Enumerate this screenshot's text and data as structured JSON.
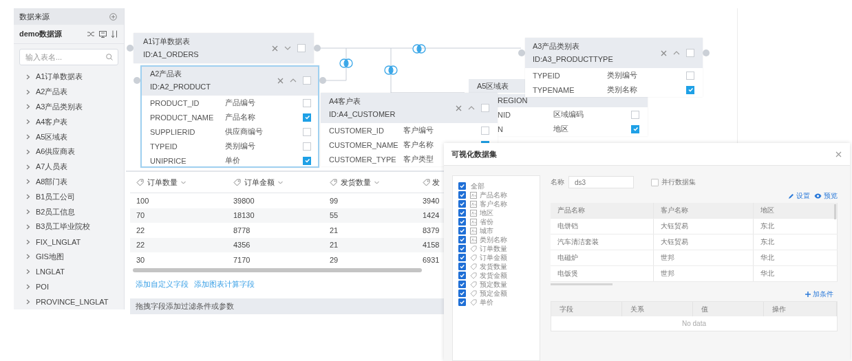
{
  "sidebar": {
    "title": "数据来源",
    "source": "demo数据源",
    "search": {
      "placeholder": "输入表名..."
    },
    "items": [
      {
        "label": "A1订单数据表",
        "expanded": false
      },
      {
        "label": "A2产品表",
        "expanded": false
      },
      {
        "label": "A3产品类别表",
        "expanded": false
      },
      {
        "label": "A4客户表",
        "expanded": false
      },
      {
        "label": "A5区域表",
        "expanded": false
      },
      {
        "label": "A6供应商表",
        "expanded": false
      },
      {
        "label": "A7人员表",
        "expanded": false
      },
      {
        "label": "A8部门表",
        "expanded": false
      },
      {
        "label": "B1员工公司",
        "expanded": false
      },
      {
        "label": "B2员工信息",
        "expanded": false
      },
      {
        "label": "B3员工毕业院校",
        "expanded": false
      },
      {
        "label": "FIX_LNGLAT",
        "expanded": false
      },
      {
        "label": "GIS地图",
        "expanded": false
      },
      {
        "label": "LNGLAT",
        "expanded": false
      },
      {
        "label": "POI",
        "expanded": false
      },
      {
        "label": "PROVINCE_LNGLAT",
        "expanded": false
      }
    ]
  },
  "canvas": {
    "nodes": [
      {
        "title": "A5区域表",
        "id": "REGION",
        "fields": [
          {
            "name": "NID",
            "label": "区域编码",
            "checked": false
          },
          {
            "name": "N",
            "label": "地区",
            "checked": true
          }
        ]
      },
      {
        "title": "A4客户表",
        "id": "ID:A4_CUSTOMER",
        "collapsed": false,
        "checked": false,
        "fields": [
          {
            "name": "CUSTOMER_ID",
            "label": "客户编号",
            "checked": false
          },
          {
            "name": "CUSTOMER_NAME",
            "label": "客户名称",
            "checked": true
          },
          {
            "name": "CUSTOMER_TYPE",
            "label": "客户类型"
          }
        ]
      },
      {
        "title": "A1订单数据表",
        "id": "ID:A1_ORDERS",
        "collapsed": true,
        "checked": false
      },
      {
        "title": "A2产品表",
        "id": "ID:A2_PRODUCT",
        "collapsed": false,
        "checked": false,
        "selected": true,
        "fields": [
          {
            "name": "PRODUCT_ID",
            "label": "产品编号",
            "checked": false
          },
          {
            "name": "PRODUCT_NAME",
            "label": "产品名称",
            "checked": true
          },
          {
            "name": "SUPPLIERID",
            "label": "供应商编号",
            "checked": false
          },
          {
            "name": "TYPEID",
            "label": "类别编号",
            "checked": false
          },
          {
            "name": "UNIPRICE",
            "label": "单价",
            "checked": true
          }
        ]
      },
      {
        "title": "A3产品类别表",
        "id": "ID:A3_PRODUCTTYPE",
        "collapsed": false,
        "checked": false,
        "fields": [
          {
            "name": "TYPEID",
            "label": "类别编号",
            "checked": false
          },
          {
            "name": "TYPENAME",
            "label": "类别名称",
            "checked": true
          }
        ]
      }
    ]
  },
  "table": {
    "columns": [
      {
        "label": "订单数量"
      },
      {
        "label": "订单金额"
      },
      {
        "label": "发货数量"
      },
      {
        "label": "发"
      }
    ],
    "rows": [
      [
        "100",
        "39800",
        "99",
        "3940"
      ],
      [
        "70",
        "18130",
        "55",
        "1424"
      ],
      [
        "22",
        "8778",
        "21",
        "8379"
      ],
      [
        "22",
        "4356",
        "21",
        "4158"
      ],
      [
        "30",
        "7170",
        "29",
        "6931"
      ]
    ]
  },
  "links": [
    "添加自定义字段",
    "添加图表计算字段"
  ],
  "filter_placeholder": "拖拽字段添加过滤条件或参数",
  "dialog": {
    "title": "可视化数据集",
    "fields": [
      {
        "label": "全部",
        "kind": "all",
        "checked": true
      },
      {
        "label": "产品名称",
        "kind": "text",
        "checked": true
      },
      {
        "label": "客户名称",
        "kind": "text",
        "checked": true
      },
      {
        "label": "地区",
        "kind": "text",
        "checked": true
      },
      {
        "label": "省份",
        "kind": "text",
        "checked": true
      },
      {
        "label": "城市",
        "kind": "text",
        "checked": true
      },
      {
        "label": "类别名称",
        "kind": "text",
        "checked": true
      },
      {
        "label": "订单数量",
        "kind": "number",
        "checked": true
      },
      {
        "label": "订单金额",
        "kind": "number",
        "checked": true
      },
      {
        "label": "发货数量",
        "kind": "number",
        "checked": true
      },
      {
        "label": "发货金额",
        "kind": "number",
        "checked": true
      },
      {
        "label": "预定数量",
        "kind": "number",
        "checked": true
      },
      {
        "label": "预定金额",
        "kind": "number",
        "checked": true
      },
      {
        "label": "单价",
        "kind": "number",
        "checked": true
      }
    ],
    "name_label": "名称",
    "name_value": "ds3",
    "parallel": {
      "label": "并行数据集",
      "checked": false
    },
    "actions": [
      {
        "kind": "edit",
        "label": "设置"
      },
      {
        "kind": "preview",
        "label": "预览"
      }
    ],
    "preview": {
      "columns": [
        "产品名称",
        "客户名称",
        "地区"
      ],
      "rows": [
        [
          "电饼铛",
          "大钰贸易",
          "东北"
        ],
        [
          "汽车清洁套装",
          "大钰贸易",
          "东北"
        ],
        [
          "电磁炉",
          "世邦",
          "华北"
        ],
        [
          "电饭煲",
          "世邦",
          "华北"
        ]
      ]
    },
    "add_condition": "加条件",
    "conditions": {
      "columns": [
        "字段",
        "关系",
        "值",
        "操作"
      ],
      "empty": "No data"
    }
  }
}
